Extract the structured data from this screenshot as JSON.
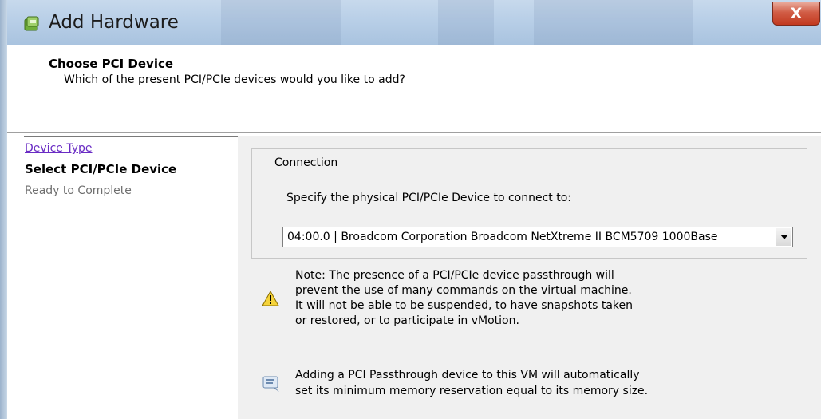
{
  "window": {
    "title": "Add Hardware",
    "close_glyph": "X",
    "icon": "add-hardware-icon"
  },
  "header": {
    "title": "Choose PCI Device",
    "subtitle": "Which of the present PCI/PCIe devices would you like to add?"
  },
  "nav": {
    "items": [
      {
        "label": "Device Type",
        "state": "link"
      },
      {
        "label": "Select PCI/PCIe Device",
        "state": "current"
      },
      {
        "label": "Ready to Complete",
        "state": "pending"
      }
    ]
  },
  "connection": {
    "group_label": "Connection",
    "instruction": "Specify the physical PCI/PCIe Device to connect to:",
    "device_selected": "04:00.0 |  Broadcom Corporation Broadcom NetXtreme II BCM5709 1000Base"
  },
  "notes": {
    "warning_icon": "warning-icon",
    "warning_text": "Note: The presence of a PCI/PCIe device passthrough will\nprevent the use of many commands on the virtual machine.\nIt will not be able to be suspended, to have snapshots taken\nor restored, or to participate in vMotion.",
    "info_icon": "info-icon",
    "info_text": "Adding a PCI Passthrough device to this VM will automatically\nset its minimum memory reservation equal to its memory size."
  },
  "colors": {
    "titlebar": "#bad0e8",
    "close_button": "#c2391f",
    "panel_background": "#f0f0f0",
    "link": "#6a2cc4",
    "warning_yellow": "#f5d33a"
  }
}
